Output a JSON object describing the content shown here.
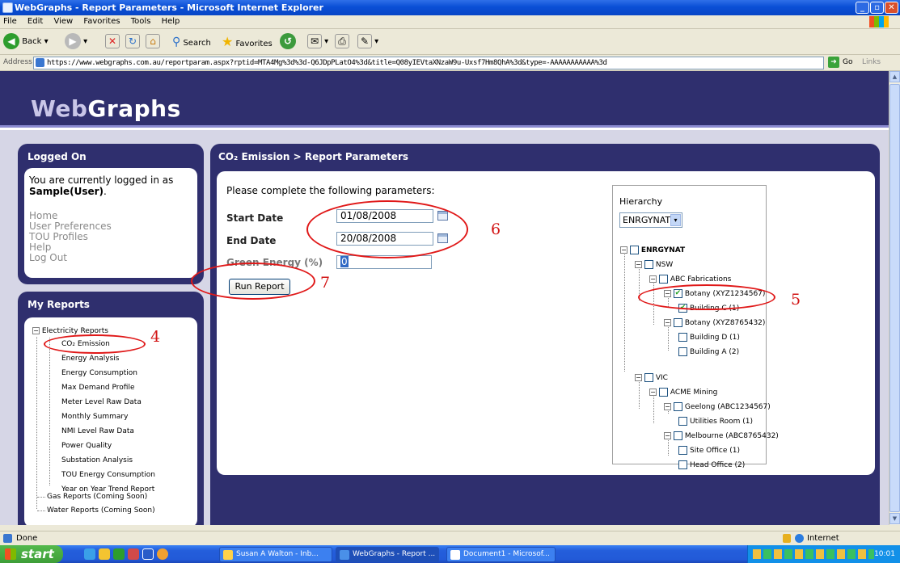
{
  "window": {
    "title": "WebGraphs - Report Parameters - Microsoft Internet Explorer"
  },
  "menu": [
    "File",
    "Edit",
    "View",
    "Favorites",
    "Tools",
    "Help"
  ],
  "toolbar": {
    "back": "Back",
    "search": "Search",
    "favorites": "Favorites"
  },
  "address": {
    "label": "Address",
    "url": "https://www.webgraphs.com.au/reportparam.aspx?rptid=MTA4Mg%3d%3d-Q6JDpPLatO4%3d&title=Q08yIEVtaXNzaW9u-Uxsf7Hm8QhA%3d&type=-AAAAAAAAAAA%3d",
    "go": "Go",
    "links": "Links"
  },
  "logo": {
    "part1": "Web",
    "part2": "Graphs"
  },
  "logged_on": {
    "title": "Logged On",
    "message": "You are currently logged in as",
    "user": "Sample(User)",
    "links": [
      "Home",
      "User Preferences",
      "TOU Profiles",
      "Help",
      "Log Out"
    ]
  },
  "my_reports": {
    "title": "My Reports",
    "root": "Electricity Reports",
    "items": [
      "CO₂ Emission",
      "Energy Analysis",
      "Energy Consumption",
      "Max Demand Profile",
      "Meter Level Raw Data",
      "Monthly Summary",
      "NMI Level Raw Data",
      "Power Quality",
      "Substation Analysis",
      "TOU Energy Consumption",
      "Year on Year Trend Report"
    ],
    "others": [
      "Gas Reports (Coming Soon)",
      "Water Reports (Coming Soon)"
    ]
  },
  "main": {
    "title": "CO₂ Emission > Report Parameters",
    "intro": "Please complete the following parameters:",
    "start_label": "Start Date",
    "start_value": "01/08/2008",
    "end_label": "End Date",
    "end_value": "20/08/2008",
    "green_label": "Green Energy (%)",
    "green_value": "0",
    "run_button": "Run Report"
  },
  "hierarchy": {
    "label": "Hierarchy",
    "selected": "ENRGYNAT",
    "nodes": [
      "ENRGYNAT",
      "NSW",
      "ABC Fabrications",
      "Botany (XYZ1234567)",
      "Building C (1)",
      "Botany (XYZ8765432)",
      "Building D (1)",
      "Building A (2)",
      "VIC",
      "ACME Mining",
      "Geelong (ABC1234567)",
      "Utilities Room (1)",
      "Melbourne (ABC8765432)",
      "Site Office (1)",
      "Head Office (2)"
    ]
  },
  "annotations": [
    "4",
    "5",
    "6",
    "7"
  ],
  "status": {
    "text": "Done",
    "zone": "Internet"
  },
  "taskbar": {
    "start": "start",
    "tasks": [
      "Susan A Walton - Inb...",
      "WebGraphs - Report ...",
      "Document1 - Microsof..."
    ],
    "clock": "10:01"
  }
}
